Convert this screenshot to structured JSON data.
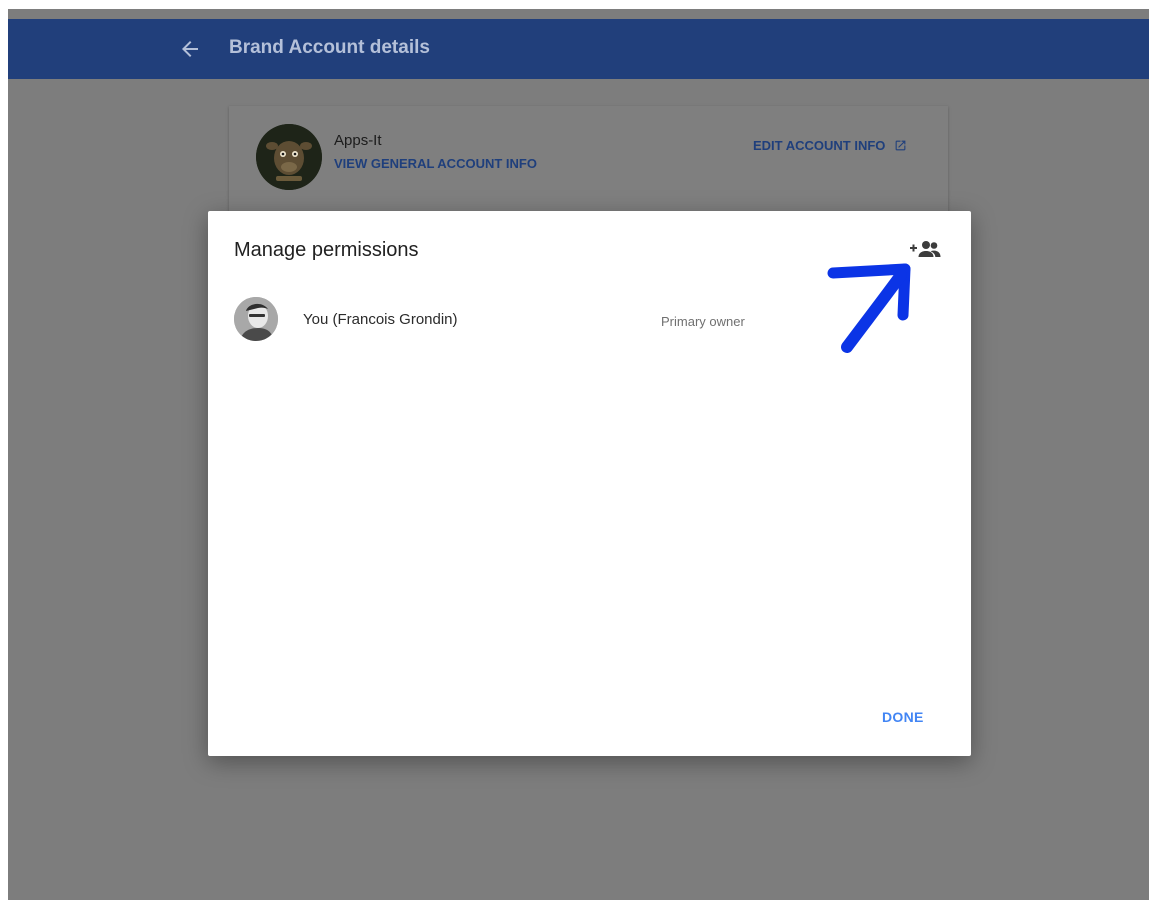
{
  "appbar": {
    "title": "Brand Account details"
  },
  "account": {
    "name": "Apps-It",
    "view_general_label": "VIEW GENERAL ACCOUNT INFO",
    "edit_label": "EDIT ACCOUNT INFO"
  },
  "dialog": {
    "title": "Manage permissions",
    "members": [
      {
        "name": "You (Francois Grondin)",
        "role": "Primary owner"
      }
    ],
    "done_label": "DONE"
  },
  "icons": {
    "back": "arrow-back-icon",
    "edit": "open-in-new-icon",
    "add_people": "group-add-icon"
  },
  "colors": {
    "appbar": "#213f7b",
    "overlay": "#7d7d7d",
    "accent": "#4285f4",
    "annotation": "#0b34e6"
  }
}
